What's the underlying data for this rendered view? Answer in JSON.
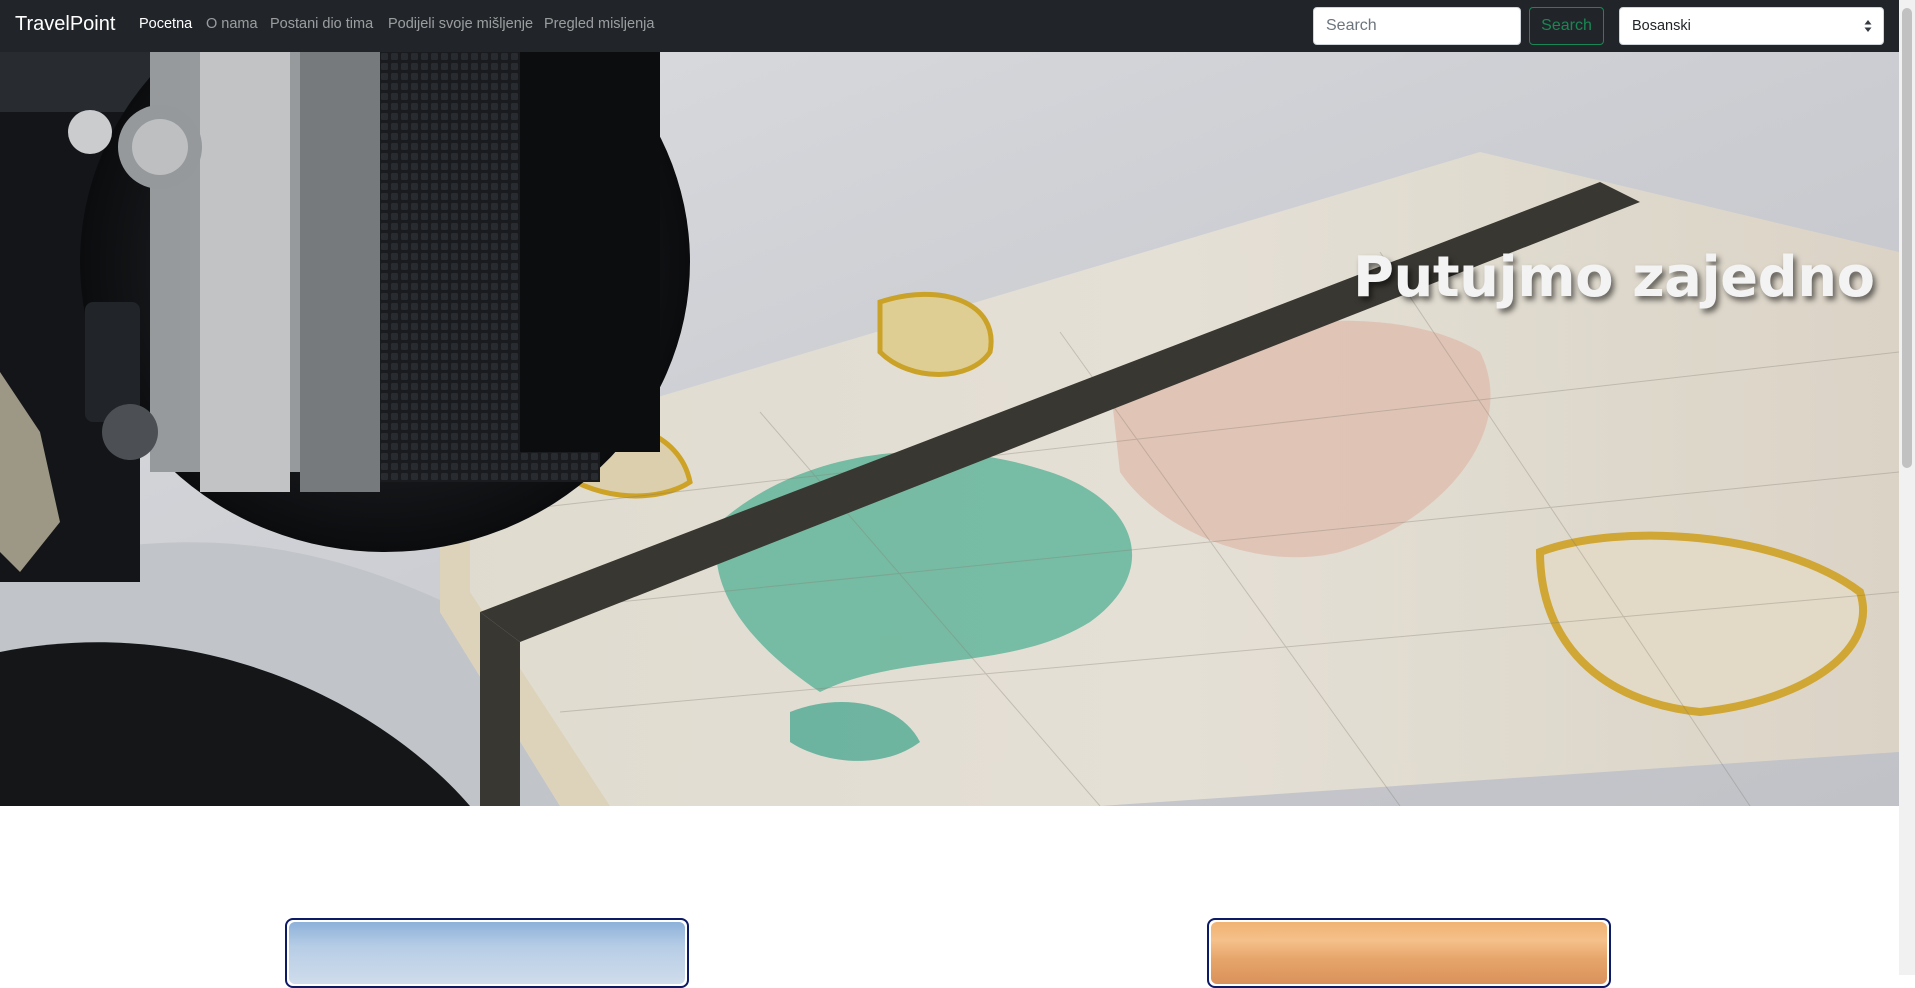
{
  "navbar": {
    "brand": "TravelPoint",
    "links": [
      {
        "label": "Pocetna",
        "active": true
      },
      {
        "label": "O nama",
        "active": false
      },
      {
        "label": "Postani dio tima",
        "active": false
      },
      {
        "label": "Podijeli svoje mišljenje",
        "active": false
      },
      {
        "label": "Pregled misljenja",
        "active": false
      }
    ],
    "search": {
      "placeholder": "Search",
      "value": ""
    },
    "search_button": "Search",
    "language": {
      "selected": "Bosanski"
    }
  },
  "hero": {
    "title": "Putujmo zajedno",
    "image_alt": "camera and map notebook"
  },
  "cards": [
    {
      "name": "card-1"
    },
    {
      "name": "card-2"
    }
  ],
  "colors": {
    "navbar_bg": "#212529",
    "search_button_accent": "#198754",
    "card_border": "#0d1b66"
  }
}
